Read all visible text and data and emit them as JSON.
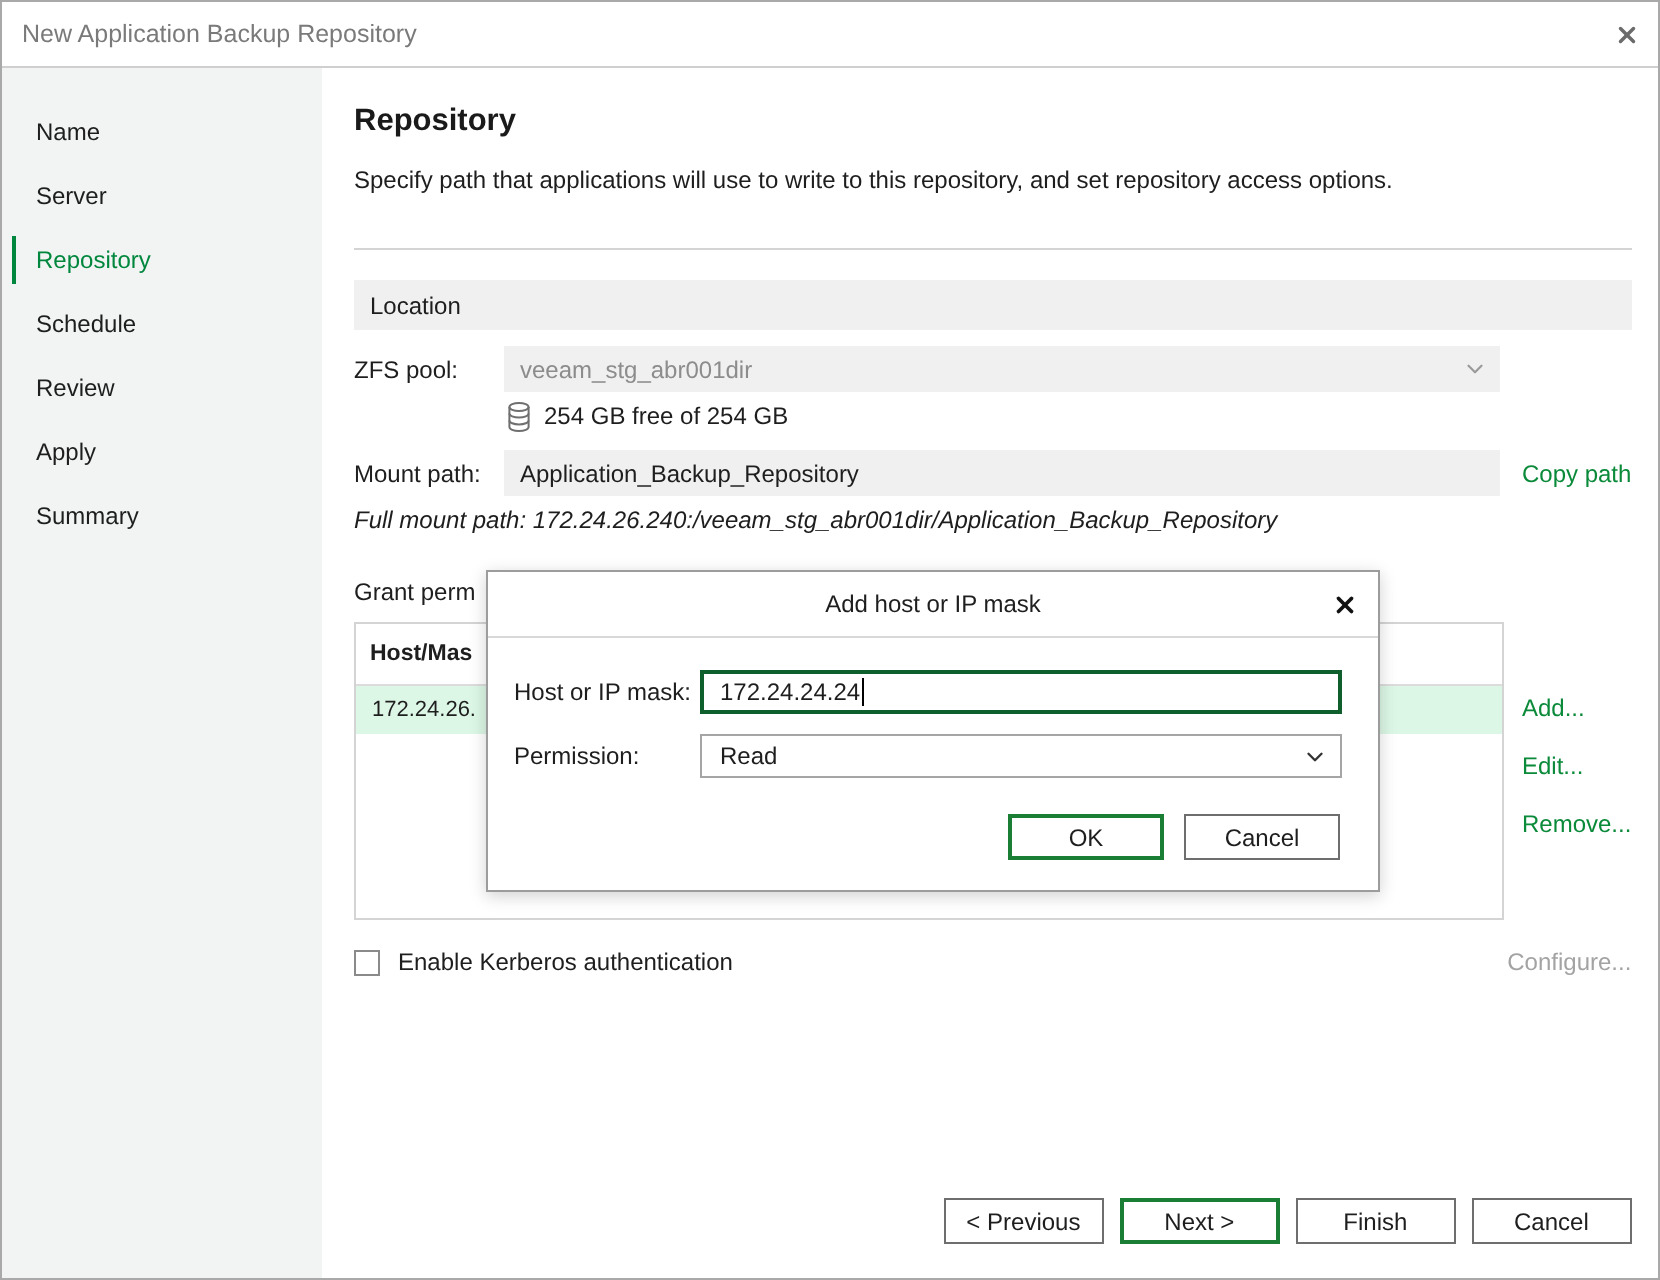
{
  "window": {
    "title": "New Application Backup Repository"
  },
  "steps": [
    {
      "label": "Name",
      "selected": false
    },
    {
      "label": "Server",
      "selected": false
    },
    {
      "label": "Repository",
      "selected": true
    },
    {
      "label": "Schedule",
      "selected": false
    },
    {
      "label": "Review",
      "selected": false
    },
    {
      "label": "Apply",
      "selected": false
    },
    {
      "label": "Summary",
      "selected": false
    }
  ],
  "page": {
    "heading": "Repository",
    "description": "Specify path that applications will use to write to this repository, and set repository access options."
  },
  "location": {
    "section_title": "Location",
    "zfs_pool": {
      "label": "ZFS pool:",
      "value": "veeam_stg_abr001dir",
      "disabled": true
    },
    "free_space": "254 GB free of 254 GB",
    "mount_path": {
      "label": "Mount path:",
      "value": "Application_Backup_Repository"
    },
    "copy_path_link": "Copy path",
    "full_mount_path": "Full mount path: 172.24.26.240:/veeam_stg_abr001dir/Application_Backup_Repository"
  },
  "permissions": {
    "label": "Grant perm",
    "table": {
      "columns": [
        "Host/Mas"
      ],
      "rows": [
        {
          "cells": [
            "172.24.26."
          ],
          "selected": true
        }
      ]
    },
    "actions": [
      {
        "label": "Add..."
      },
      {
        "label": "Edit..."
      },
      {
        "label": "Remove..."
      }
    ]
  },
  "kerberos": {
    "label": "Enable Kerberos authentication",
    "checked": false,
    "configure_link": {
      "label": "Configure...",
      "disabled": true
    }
  },
  "buttons": [
    {
      "label": "< Previous",
      "default": false
    },
    {
      "label": "Next >",
      "default": true
    },
    {
      "label": "Finish",
      "default": false
    },
    {
      "label": "Cancel",
      "default": false
    }
  ],
  "dialog": {
    "title": "Add host or IP mask",
    "fields": [
      {
        "kind": "text",
        "label": "Host or IP mask:",
        "value": "172.24.24.24",
        "focused": true
      },
      {
        "kind": "select",
        "label": "Permission:",
        "value": "Read",
        "focused": false
      }
    ],
    "buttons": [
      {
        "label": "OK",
        "default": true
      },
      {
        "label": "Cancel",
        "default": false
      }
    ]
  }
}
